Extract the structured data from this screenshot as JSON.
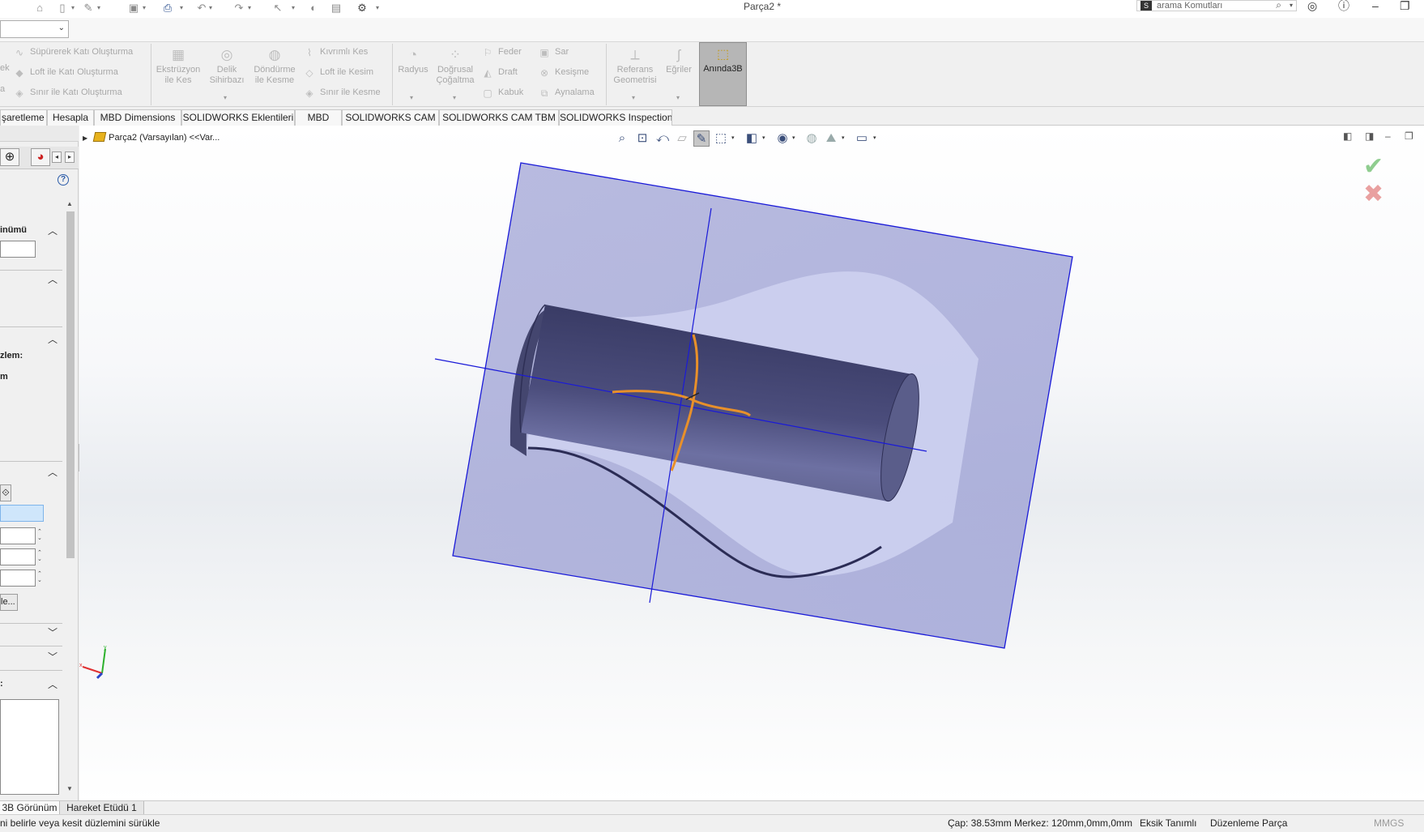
{
  "window": {
    "title": "Parça2 *",
    "search_placeholder": "arama Komutları"
  },
  "ribbon": {
    "sweep_boss": "Süpürerek Katı Oluşturma",
    "loft_boss": "Loft ile Katı Oluşturma",
    "boundary_boss": "Sınır ile Katı Oluşturma",
    "left_cut1": "ek",
    "left_cut2": "a",
    "extruded_cut": "Ekstrüzyon\nile Kes",
    "hole_wizard": "Delik\nSihirbazı",
    "revolved_cut": "Döndürme\nile Kesme",
    "swept_cut": "Kıvrımlı Kes",
    "lofted_cut": "Loft ile Kesim",
    "boundary_cut": "Sınır ile Kesme",
    "fillet": "Radyus",
    "linear_pattern": "Doğrusal\nÇoğaltma",
    "rib": "Feder",
    "wrap": "Sar",
    "draft": "Draft",
    "intersect": "Kesişme",
    "shell": "Kabuk",
    "mirror": "Aynalama",
    "reference_geometry": "Referans\nGeometrisi",
    "curves": "Eğriler",
    "instant3d": "Anında3B"
  },
  "tabs": [
    "şaretleme",
    "Hesapla",
    "MBD Dimensions",
    "SOLIDWORKS Eklentileri",
    "MBD",
    "SOLIDWORKS CAM",
    "SOLIDWORKS CAM TBM",
    "SOLIDWORKS Inspection"
  ],
  "left_panel": {
    "section1_label": "inümü",
    "section3_label1": "zlem:",
    "section3_label2": "m",
    "button_label": "le..."
  },
  "viewport": {
    "tree_root": "Parça2 (Varsayılan) <<Var..."
  },
  "bottom_tabs": [
    "3B Görünüm",
    "Hareket Etüdü 1"
  ],
  "status": {
    "hint": "ni belirle veya kesit düzlemini sürükle",
    "diameter": "Çap: 38.53mm",
    "center": "Merkez: 120mm,0mm,0mm",
    "definition": "Eksik Tanımlı",
    "mode": "Düzenleme Parça",
    "units": "MMGS"
  },
  "colors": {
    "plane_fill": "#9da3d6",
    "plane_edge": "#1a1ad8",
    "cylinder": "#4e507e",
    "sketch_orange": "#e8902a",
    "accent_active": "#b6b6b6"
  }
}
